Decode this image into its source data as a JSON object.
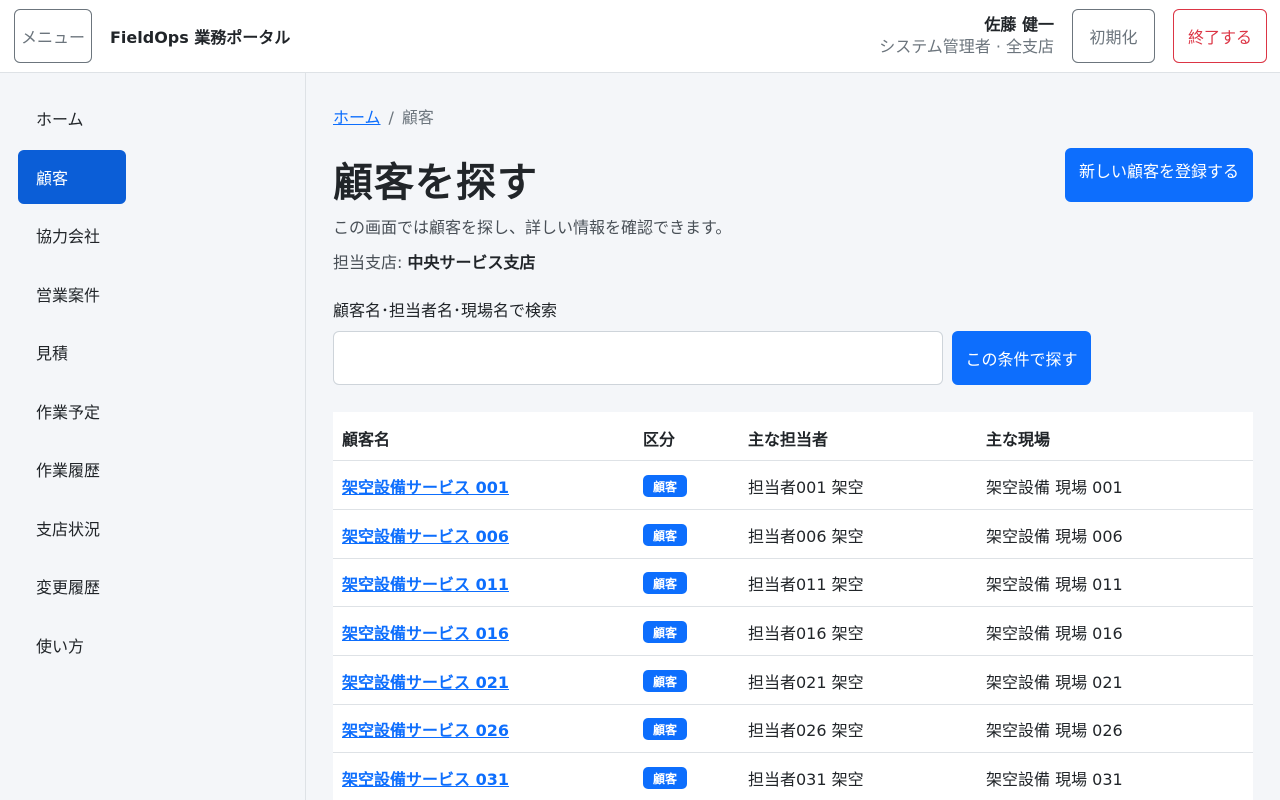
{
  "header": {
    "menu_label": "メニュー",
    "app_title": "FieldOps 業務ポータル",
    "user_name": "佐藤 健一",
    "user_role": "システム管理者 · 全支店",
    "reset_label": "初期化",
    "logout_label": "終了する"
  },
  "sidebar": {
    "items": [
      {
        "label": "ホーム"
      },
      {
        "label": "顧客"
      },
      {
        "label": "協力会社"
      },
      {
        "label": "営業案件"
      },
      {
        "label": "見積"
      },
      {
        "label": "作業予定"
      },
      {
        "label": "作業履歴"
      },
      {
        "label": "支店状況"
      },
      {
        "label": "変更履歴"
      },
      {
        "label": "使い方"
      }
    ],
    "active_index": 1
  },
  "main": {
    "breadcrumb_home": "ホーム",
    "breadcrumb_sep": "/",
    "breadcrumb_current": "顧客",
    "title": "顧客を探す",
    "new_button": "新しい顧客を登録する",
    "description": "この画面では顧客を探し、詳しい情報を確認できます。",
    "branch_label": "担当支店:",
    "branch_value": "中央サービス支店",
    "search_label": "顧客名･担当者名･現場名で検索",
    "search_value": "",
    "search_button": "この条件で探す"
  },
  "table": {
    "headers": [
      "顧客名",
      "区分",
      "主な担当者",
      "主な現場"
    ],
    "rows": [
      {
        "name": "架空設備サービス 001",
        "type": "顧客",
        "contact": "担当者001 架空",
        "site": "架空設備 現場 001"
      },
      {
        "name": "架空設備サービス 006",
        "type": "顧客",
        "contact": "担当者006 架空",
        "site": "架空設備 現場 006"
      },
      {
        "name": "架空設備サービス 011",
        "type": "顧客",
        "contact": "担当者011 架空",
        "site": "架空設備 現場 011"
      },
      {
        "name": "架空設備サービス 016",
        "type": "顧客",
        "contact": "担当者016 架空",
        "site": "架空設備 現場 016"
      },
      {
        "name": "架空設備サービス 021",
        "type": "顧客",
        "contact": "担当者021 架空",
        "site": "架空設備 現場 021"
      },
      {
        "name": "架空設備サービス 026",
        "type": "顧客",
        "contact": "担当者026 架空",
        "site": "架空設備 現場 026"
      },
      {
        "name": "架空設備サービス 031",
        "type": "顧客",
        "contact": "担当者031 架空",
        "site": "架空設備 現場 031"
      }
    ]
  },
  "colors": {
    "primary": "#0d6efd",
    "active_nav": "#0b5ed7",
    "danger": "#dc3545",
    "background": "#f4f6f9"
  }
}
